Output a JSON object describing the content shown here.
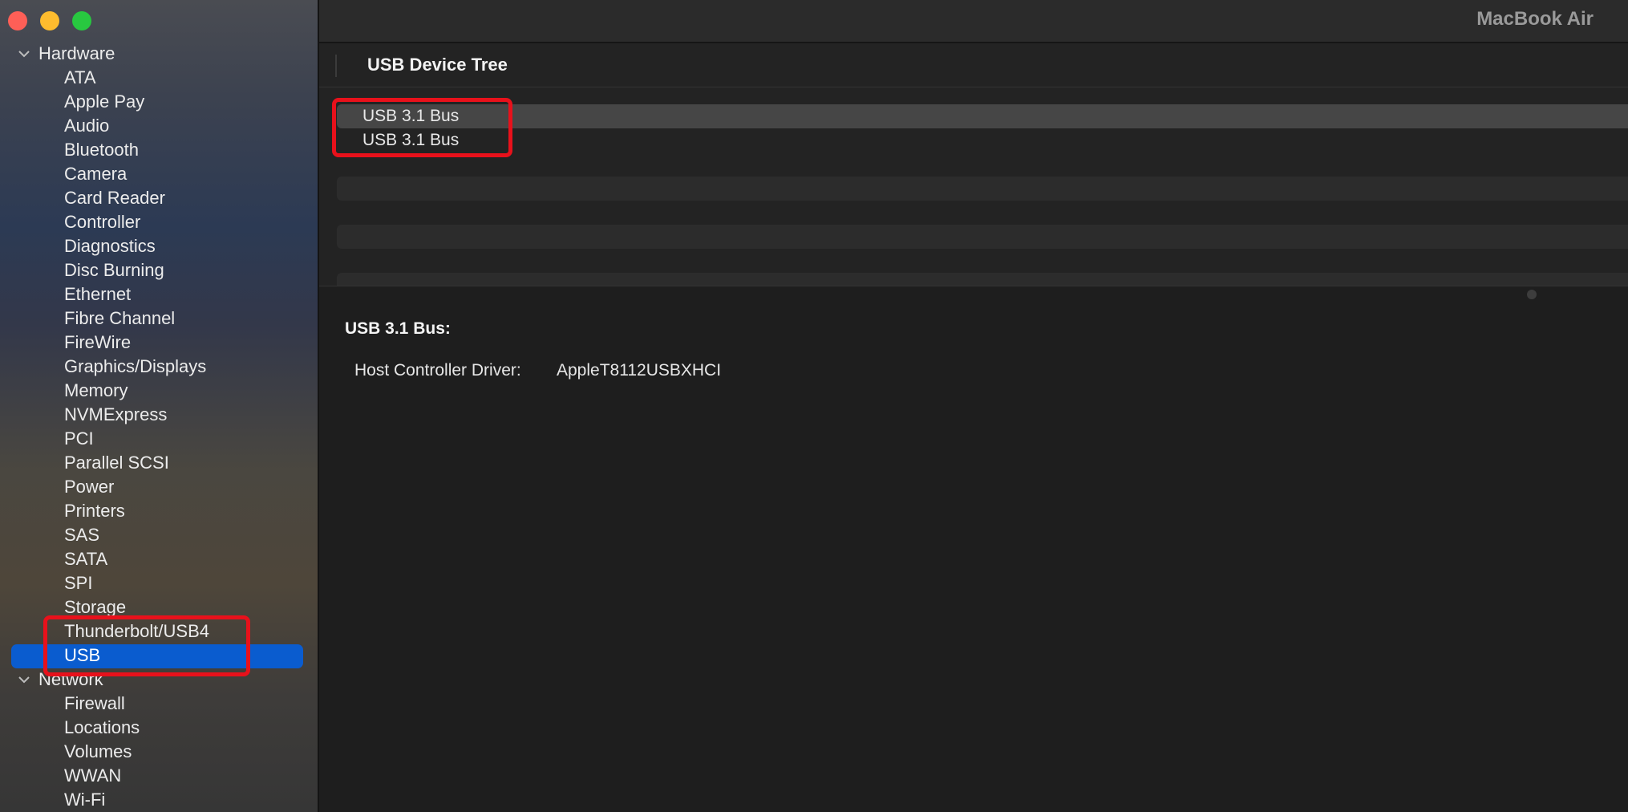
{
  "window": {
    "title": "MacBook Air"
  },
  "sidebar": {
    "groups": [
      {
        "label": "Hardware",
        "items": [
          "ATA",
          "Apple Pay",
          "Audio",
          "Bluetooth",
          "Camera",
          "Card Reader",
          "Controller",
          "Diagnostics",
          "Disc Burning",
          "Ethernet",
          "Fibre Channel",
          "FireWire",
          "Graphics/Displays",
          "Memory",
          "NVMExpress",
          "PCI",
          "Parallel SCSI",
          "Power",
          "Printers",
          "SAS",
          "SATA",
          "SPI",
          "Storage",
          "Thunderbolt/USB4",
          "USB"
        ]
      },
      {
        "label": "Network",
        "items": [
          "Firewall",
          "Locations",
          "Volumes",
          "WWAN",
          "Wi-Fi"
        ]
      }
    ],
    "selected": "USB",
    "colors": {
      "selection": "#0a5ccf"
    }
  },
  "device_tree": {
    "column_title": "USB Device Tree",
    "rows": [
      "USB 3.1 Bus",
      "USB 3.1 Bus"
    ]
  },
  "detail": {
    "title": "USB 3.1 Bus:",
    "fields": [
      {
        "key": "Host Controller Driver:",
        "value": "AppleT8112USBXHCI"
      }
    ]
  },
  "annotations": {
    "highlight_color": "#e8111b"
  }
}
